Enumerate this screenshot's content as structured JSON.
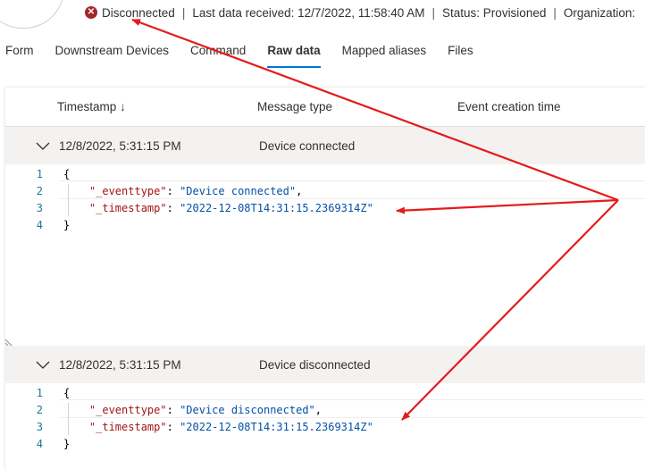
{
  "status": {
    "connection": "Disconnected",
    "last_data": "Last data received: 12/7/2022, 11:58:40 AM",
    "state": "Status: Provisioned",
    "org": "Organization:",
    "separator": "|"
  },
  "tabs": [
    {
      "label": "Form",
      "active": false
    },
    {
      "label": "Downstream Devices",
      "active": false
    },
    {
      "label": "Command",
      "active": false
    },
    {
      "label": "Raw data",
      "active": true
    },
    {
      "label": "Mapped aliases",
      "active": false
    },
    {
      "label": "Files",
      "active": false
    }
  ],
  "grid": {
    "columns": [
      "Timestamp ↓",
      "Message type",
      "Event creation time"
    ],
    "rows": [
      {
        "timestamp": "12/8/2022, 5:31:15 PM",
        "message_type": "Device connected",
        "code": {
          "line_numbers": [
            "1",
            "2",
            "3",
            "4"
          ],
          "open_brace": "{",
          "eventtype_key": "\"_eventtype\"",
          "eventtype_value": "\"Device connected\"",
          "timestamp_key": "\"_timestamp\"",
          "timestamp_value": "\"2022-12-08T14:31:15.2369314Z\"",
          "close_brace": "}"
        }
      },
      {
        "timestamp": "12/8/2022, 5:31:15 PM",
        "message_type": "Device disconnected",
        "code": {
          "line_numbers": [
            "1",
            "2",
            "3",
            "4"
          ],
          "open_brace": "{",
          "eventtype_key": "\"_eventtype\"",
          "eventtype_value": "\"Device disconnected\"",
          "timestamp_key": "\"_timestamp\"",
          "timestamp_value": "\"2022-12-08T14:31:15.2369314Z\"",
          "close_brace": "}"
        }
      }
    ]
  },
  "colors": {
    "accent": "#0078d4",
    "error": "#a4262c",
    "annotation": "#e41b1b"
  },
  "icons": [
    "error-circle-icon",
    "sort-down-icon",
    "chevron-down-icon",
    "resize-grip-icon"
  ]
}
